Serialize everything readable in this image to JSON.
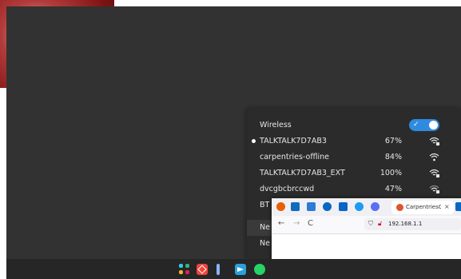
{
  "network_menu": {
    "wireless_label": "Wireless",
    "wireless_enabled": true,
    "networks": [
      {
        "ssid": "TALKTALK7D7AB3",
        "signal": "67%",
        "connected": true
      },
      {
        "ssid": "carpentries-offline",
        "signal": "84%",
        "connected": false
      },
      {
        "ssid": "TALKTALK7D7AB3_EXT",
        "signal": "100%",
        "connected": false
      },
      {
        "ssid": "dvcgbcbrccwd",
        "signal": "47%",
        "connected": false
      },
      {
        "ssid": "BT",
        "signal": "",
        "connected": false
      }
    ],
    "item_network_1": "Ne",
    "item_network_2": "Ne"
  },
  "browser": {
    "active_tab_title": "CarpentriesOf",
    "close_tab": "×",
    "url": "192.168.1.1",
    "back": "←",
    "forward": "→",
    "reload": "C"
  },
  "taskbar": {
    "apps": [
      "slack-icon",
      "anydesk-icon",
      "info-icon",
      "telegram-icon",
      "whatsapp-icon"
    ]
  },
  "colors": {
    "desktop": "#323232",
    "popover": "#2b2b2b",
    "accent": "#2f8be0",
    "taskbar": "#262626"
  }
}
